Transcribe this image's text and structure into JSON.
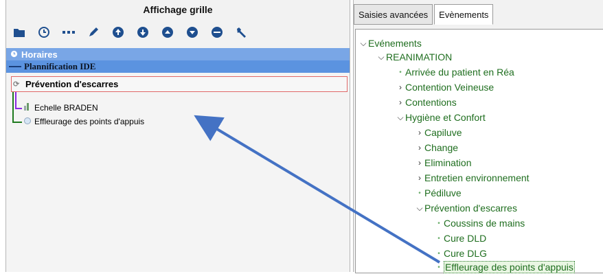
{
  "left_panel": {
    "title": "Affichage grille",
    "toolbar": [
      {
        "icon": "folder-icon"
      },
      {
        "icon": "clock-icon"
      },
      {
        "icon": "dashes-icon"
      },
      {
        "icon": "pencil-icon"
      },
      {
        "icon": "arrow-up-circle-icon"
      },
      {
        "icon": "arrow-down-circle-icon"
      },
      {
        "icon": "chevron-up-circle-icon"
      },
      {
        "icon": "chevron-down-circle-icon"
      },
      {
        "icon": "minus-circle-icon"
      },
      {
        "icon": "wrench-icon"
      }
    ],
    "rows": {
      "horaires": "Horaires",
      "planification": "Plannification IDE",
      "prevention": "Prévention d'escarres",
      "item1": "Echelle BRADEN",
      "item2": "Effleurage des points d'appuis"
    },
    "colors": {
      "header_row": "#79a6e6",
      "plan_row": "#5b93e0",
      "selected_border": "#e06767"
    }
  },
  "right_panel": {
    "tabs": [
      "Saisies avancées",
      "Evènements"
    ],
    "active_tab": "Evènements",
    "tree": [
      {
        "label": "Evénements",
        "state": "expanded"
      },
      {
        "label": "REANIMATION",
        "state": "expanded"
      },
      {
        "label": "Arrivée du patient en Réa",
        "state": "leaf"
      },
      {
        "label": "Contention Veineuse",
        "state": "collapsed"
      },
      {
        "label": "Contentions",
        "state": "collapsed"
      },
      {
        "label": "Hygiène et Confort",
        "state": "expanded"
      },
      {
        "label": "Capiluve",
        "state": "collapsed"
      },
      {
        "label": "Change",
        "state": "collapsed"
      },
      {
        "label": "Elimination",
        "state": "collapsed"
      },
      {
        "label": "Entretien environnement",
        "state": "collapsed"
      },
      {
        "label": "Pédiluve",
        "state": "leaf"
      },
      {
        "label": "Prévention d'escarres",
        "state": "expanded"
      },
      {
        "label": "Coussins de mains",
        "state": "leaf"
      },
      {
        "label": "Cure DLD",
        "state": "leaf"
      },
      {
        "label": "Cure DLG",
        "state": "leaf"
      },
      {
        "label": "Effleurage des points d'appuis",
        "state": "leaf",
        "selected": true
      }
    ],
    "colors": {
      "tree_text": "#1f6e1f"
    }
  },
  "annotation": {
    "arrow_color": "#4472c4"
  }
}
